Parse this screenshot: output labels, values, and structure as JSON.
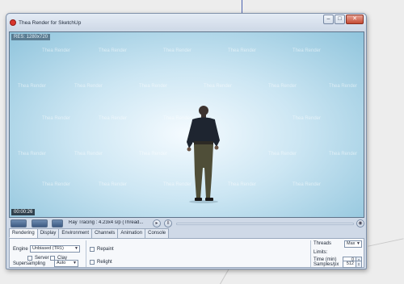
{
  "window": {
    "title": "Thea Render for SketchUp"
  },
  "render": {
    "resolution": "RES: 1280x720",
    "elapsed": "00:00:26",
    "watermark": "Thea Render"
  },
  "toolbar": {
    "status": "Ray Tracing : 4.23x4 s/p (Thread..."
  },
  "tabs": [
    "Rendering",
    "Display",
    "Environment",
    "Channels",
    "Animation",
    "Console"
  ],
  "rendering": {
    "engine_label": "Engine",
    "engine_value": "Unbiased (TR1)",
    "server_label": "Server",
    "clay_label": "Clay",
    "supersampling_label": "Supersampling",
    "supersampling_value": "Auto",
    "repaint_label": "Repaint",
    "relight_label": "Relight",
    "threads_label": "Threads",
    "threads_value": "Max",
    "limits_label": "Limits:",
    "time_label": "Time (min)",
    "time_value": "0",
    "samples_label": "Samples/px",
    "samples_value": "512"
  },
  "colors": {
    "accent": "#3c5a82",
    "close": "#c44b33"
  }
}
